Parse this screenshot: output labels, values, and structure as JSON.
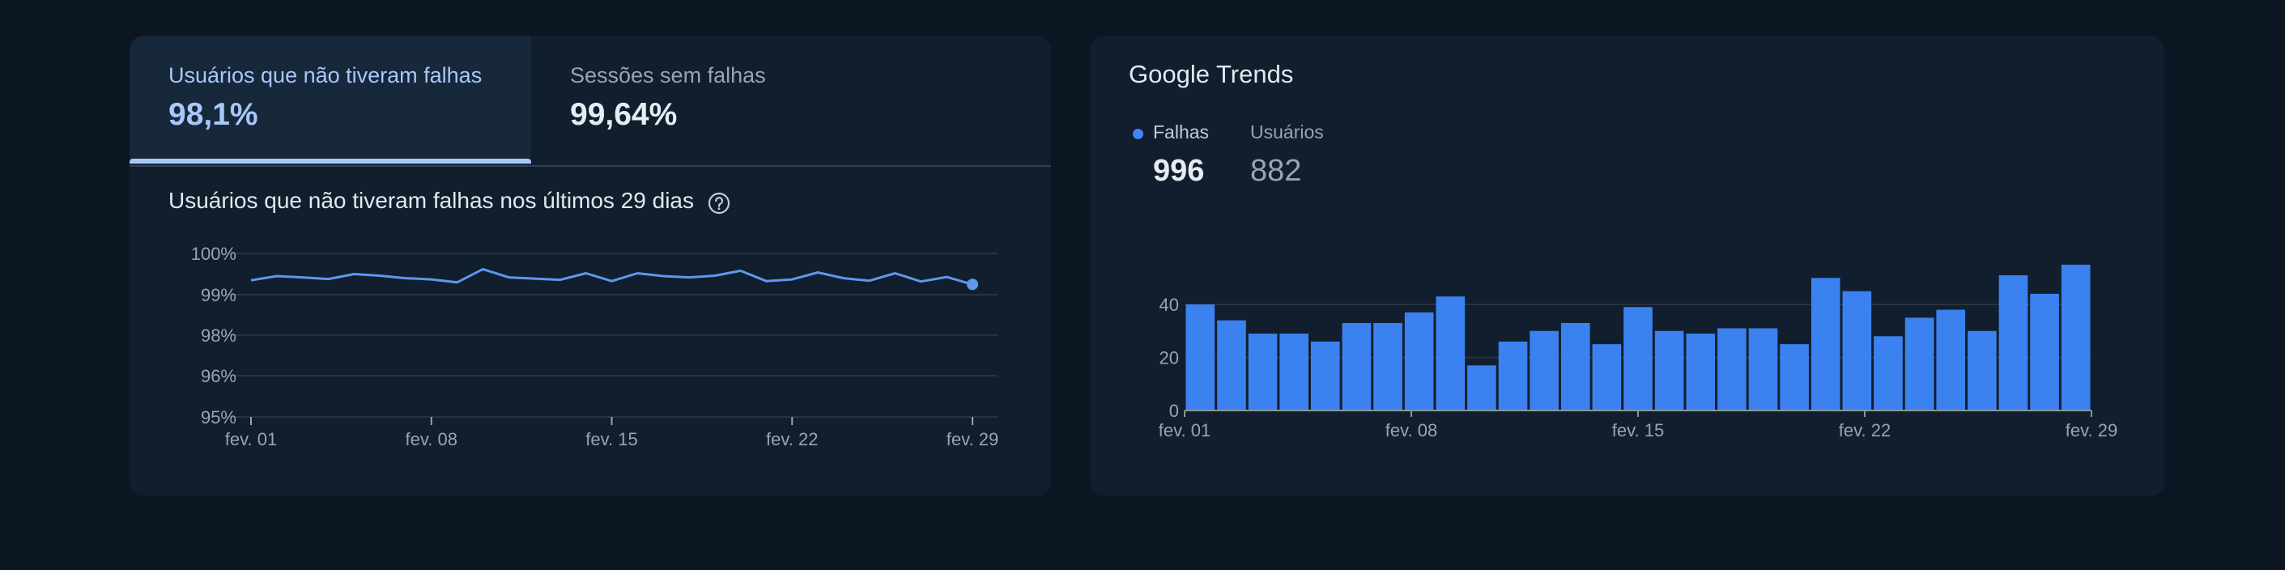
{
  "crash_free_card": {
    "tabs": [
      {
        "label": "Usuários que não tiveram falhas",
        "value": "98,1%"
      },
      {
        "label": "Sessões sem falhas",
        "value": "99,64%"
      }
    ],
    "active_tab": 0,
    "chart_title": "Usuários que não tiveram falhas nos últimos 29 dias",
    "help_icon": "help-circle-icon"
  },
  "trends_card": {
    "title": "Google Trends",
    "legend": [
      {
        "label": "Falhas",
        "value": "996"
      },
      {
        "label": "Usuários",
        "value": "882"
      }
    ]
  },
  "colors": {
    "accent": "#a9c7fa",
    "series": "#4285f4",
    "bar": "#3b82f0",
    "line": "#5f97ee",
    "background": "#0b1622",
    "card": "#101e2d"
  },
  "chart_data": [
    {
      "type": "line",
      "title": "Usuários que não tiveram falhas nos últimos 29 dias",
      "categories": [
        "fev. 01",
        "fev. 02",
        "fev. 03",
        "fev. 04",
        "fev. 05",
        "fev. 06",
        "fev. 07",
        "fev. 08",
        "fev. 09",
        "fev. 10",
        "fev. 11",
        "fev. 12",
        "fev. 13",
        "fev. 14",
        "fev. 15",
        "fev. 16",
        "fev. 17",
        "fev. 18",
        "fev. 19",
        "fev. 20",
        "fev. 21",
        "fev. 22",
        "fev. 23",
        "fev. 24",
        "fev. 25",
        "fev. 26",
        "fev. 27",
        "fev. 28",
        "fev. 29"
      ],
      "x_tick_labels": [
        "fev. 01",
        "fev. 08",
        "fev. 15",
        "fev. 22",
        "fev. 29"
      ],
      "y_tick_labels": [
        "100%",
        "99%",
        "98%",
        "96%",
        "95%"
      ],
      "y_scale": "nonlinear (labels 100%, 99%, 98%, 96%, 95% equally spaced)",
      "series": [
        {
          "values": [
            99.35,
            99.45,
            99.42,
            99.38,
            99.5,
            99.46,
            99.4,
            99.37,
            99.3,
            99.62,
            99.42,
            99.39,
            99.36,
            99.52,
            99.33,
            99.52,
            99.45,
            99.42,
            99.46,
            99.58,
            99.33,
            99.37,
            99.54,
            99.4,
            99.34,
            99.52,
            99.32,
            99.43,
            99.25
          ]
        }
      ],
      "last_point_marker": true,
      "grid": true
    },
    {
      "type": "bar",
      "title": "Google Trends",
      "categories": [
        "fev. 01",
        "fev. 02",
        "fev. 03",
        "fev. 04",
        "fev. 05",
        "fev. 06",
        "fev. 07",
        "fev. 08",
        "fev. 09",
        "fev. 10",
        "fev. 11",
        "fev. 12",
        "fev. 13",
        "fev. 14",
        "fev. 15",
        "fev. 16",
        "fev. 17",
        "fev. 18",
        "fev. 19",
        "fev. 20",
        "fev. 21",
        "fev. 22",
        "fev. 23",
        "fev. 24",
        "fev. 25",
        "fev. 26",
        "fev. 27",
        "fev. 28",
        "fev. 29"
      ],
      "x_tick_labels": [
        "fev. 01",
        "fev. 08",
        "fev. 15",
        "fev. 22",
        "fev. 29"
      ],
      "series": [
        {
          "name": "Falhas",
          "values": [
            40,
            34,
            29,
            29,
            26,
            33,
            33,
            37,
            43,
            17,
            26,
            30,
            33,
            25,
            39,
            30,
            29,
            31,
            31,
            25,
            50,
            45,
            28,
            35,
            38,
            30,
            51,
            44,
            55
          ]
        }
      ],
      "ylim": [
        0,
        58
      ],
      "y_ticks": [
        0,
        20,
        40
      ],
      "grid": true
    }
  ]
}
